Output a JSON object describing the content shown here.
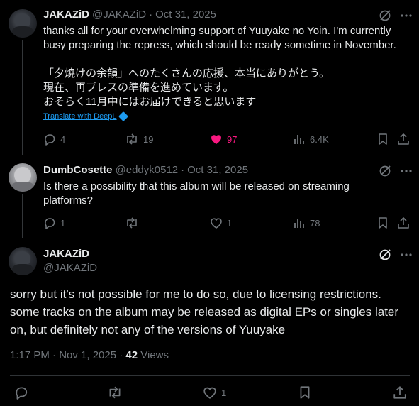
{
  "tweet1": {
    "display_name": "JAKAZiD",
    "handle": "@JAKAZiD",
    "sep": "·",
    "date": "Oct 31, 2025",
    "text_en": "thanks all for your overwhelming support of Yuuyake no Yoin. I'm currently busy preparing the repress, which should be ready sometime in November.",
    "text_jp_1": "「夕焼けの余韻」へのたくさんの応援、本当にありがとう。",
    "text_jp_2": "現在、再プレスの準備を進めています。",
    "text_jp_3": "おそらく11月中にはお届けできると思います",
    "translate_label": "Translate with DeepL",
    "replies": "4",
    "reposts": "19",
    "likes": "97",
    "views": "6.4K"
  },
  "tweet2": {
    "display_name": "DumbCosette",
    "handle": "@eddyk0512",
    "sep": "·",
    "date": "Oct 31, 2025",
    "text": "Is there a possibility that this album will be released on streaming platforms?",
    "replies": "1",
    "likes": "1",
    "views": "78"
  },
  "tweet3": {
    "display_name": "JAKAZiD",
    "handle": "@JAKAZiD",
    "text": "sorry but it's not possible for me to do so, due to licensing restrictions. some tracks on the album may be released as digital EPs or singles later on, but definitely not any of the versions of Yuuyake",
    "timestamp": "1:17 PM · Nov 1, 2025 · ",
    "views_count": "42",
    "views_label": " Views",
    "likes": "1"
  },
  "colors": {
    "background": "#000000",
    "text": "#e7e9ea",
    "muted": "#71767b",
    "like_pink": "#f91880",
    "link_blue": "#1d9bf0"
  },
  "icons": [
    "grok-icon",
    "more-icon",
    "reply-icon",
    "repost-icon",
    "like-icon",
    "views-icon",
    "bookmark-icon",
    "share-icon"
  ]
}
